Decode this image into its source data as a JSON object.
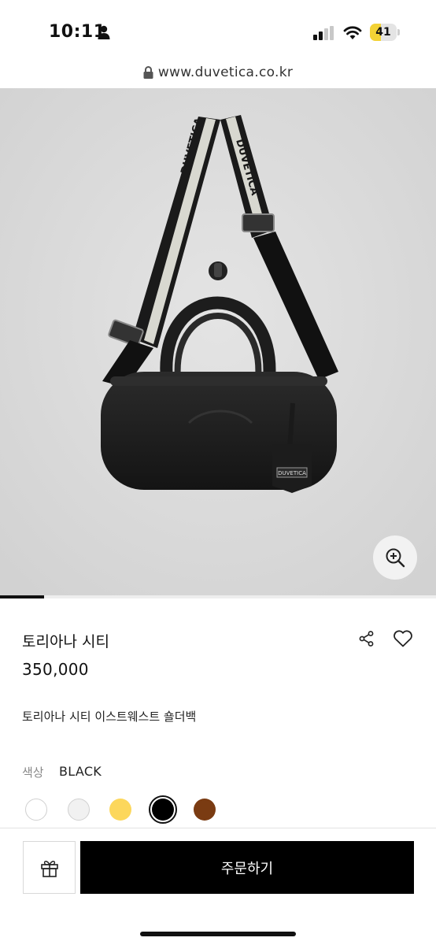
{
  "status_bar": {
    "time": "10:11",
    "battery_level": "41",
    "battery_fraction": 0.41,
    "battery_color": "#f3d235",
    "icons": [
      "person-icon",
      "signal-icon",
      "wifi-icon",
      "battery-icon"
    ]
  },
  "browser": {
    "url": "www.duvetica.co.kr"
  },
  "product": {
    "image_alt": "DUVETICA",
    "hang_tag_text": "DUVETICA",
    "strap_text": "DUVETICA",
    "name": "토리아나 시티",
    "price": "350,000",
    "description": "토리아나 시티 이스트웨스트 숄더백",
    "color_label": "색상",
    "color_value": "BLACK",
    "swatches": [
      {
        "color": "#ffffff",
        "selected": false
      },
      {
        "color": "#f1f1f1",
        "selected": false
      },
      {
        "color": "#fcd75c",
        "selected": false
      },
      {
        "color": "#000000",
        "selected": true
      },
      {
        "color": "#7a3b12",
        "selected": false
      }
    ],
    "slide_position": 1
  },
  "bottom_bar": {
    "order_label": "주문하기"
  }
}
